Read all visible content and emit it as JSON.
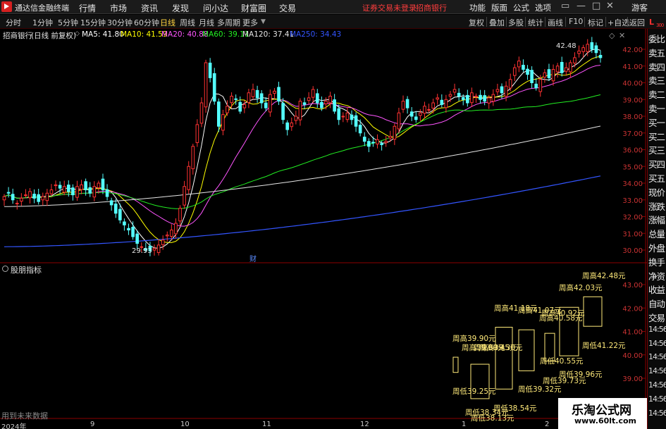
{
  "app": {
    "title": "通达信金融终端",
    "menu": [
      "行情",
      "市场",
      "资讯",
      "发现",
      "问小达",
      "财富圈",
      "交易"
    ],
    "warning": "证券交易未登录",
    "stock_short": "招商银行",
    "right_menu": [
      "功能",
      "版面",
      "公式",
      "选项"
    ],
    "guest": "游客",
    "window_buttons": [
      "▭",
      "—",
      "□",
      "✕"
    ]
  },
  "toolbar": {
    "periods": [
      "分时",
      "1分钟",
      "5分钟",
      "15分钟",
      "30分钟",
      "60分钟",
      "日线",
      "周线",
      "月线",
      "多周期",
      "更多"
    ],
    "active_period": "日线",
    "right_buttons": [
      "复权",
      "叠加",
      "多股",
      "统计",
      "画线",
      "F10",
      "标记",
      "+自选",
      "返回"
    ]
  },
  "ma_line": {
    "stock": "招商银行",
    "mode": "(日线 前复权)",
    "items": [
      {
        "text": "MA5: 41.80",
        "color": "#ffffff"
      },
      {
        "text": "MA10: 41.59",
        "color": "#ffff00"
      },
      {
        "text": "MA20: 40.88",
        "color": "#ff55ff"
      },
      {
        "text": "MA60: 39.11",
        "color": "#22ee22"
      },
      {
        "text": "MA120: 37.41",
        "color": "#e6e6e6"
      },
      {
        "text": "MA250: 34.43",
        "color": "#3355ff"
      }
    ]
  },
  "right_panel": {
    "top_label": "L",
    "top_sub": "300",
    "items": [
      "委比",
      "卖五",
      "卖四",
      "卖三",
      "卖二",
      "卖一",
      "买一",
      "买二",
      "买三",
      "买四",
      "买五",
      "现价",
      "涨跌",
      "涨幅",
      "总量",
      "外盘",
      "换手",
      "净资",
      "收益",
      "自动",
      "交易",
      "14:56",
      "14:56",
      "14:56",
      "14:56",
      "14:56",
      "14:56",
      "14:56"
    ]
  },
  "main_chart": {
    "y_ticks": [
      "42.00",
      "41.00",
      "40.00",
      "39.00",
      "38.00",
      "37.00",
      "36.00",
      "35.00",
      "34.00",
      "33.00",
      "32.00",
      "31.00",
      "30.00"
    ],
    "high_label": "42.48",
    "low_label": "29.93",
    "marker": "财"
  },
  "sub_chart": {
    "title": "股朋指标",
    "y_ticks": [
      "43.00",
      "42.00",
      "41.00",
      "40.00",
      "39.00"
    ],
    "labels": [
      "周高42.48元",
      "周高42.03元",
      "周高41.18元",
      "周高41.07元",
      "周高40.92元",
      "周高40.58元",
      "周高39.90元",
      "周高39.60元",
      "周高39.45元",
      "周高39.30元",
      "周低41.22元",
      "周低40.55元",
      "周低39.96元",
      "周低39.73元",
      "周低39.32元",
      "周低39.25元",
      "周低38.54元",
      "周低38.34元",
      "周低38.13元"
    ],
    "future_note": "用到未来数据"
  },
  "x_axis": {
    "labels": [
      "2024年",
      "9",
      "10",
      "11",
      "12",
      "1",
      "2"
    ]
  },
  "watermark": {
    "line1": "乐淘公式网",
    "line2": "www.60lt.com"
  },
  "chart_data": {
    "type": "candlestick",
    "title": "招商银行 (日线 前复权)",
    "x_labels": [
      "2024年",
      "9",
      "10",
      "11",
      "12",
      "1",
      "2"
    ],
    "ylim": [
      29.5,
      42.8
    ],
    "ma": {
      "MA5": 41.8,
      "MA10": 41.59,
      "MA20": 40.88,
      "MA60": 39.11,
      "MA120": 37.41,
      "MA250": 34.43
    },
    "close_series": [
      33.2,
      33.4,
      33.0,
      32.8,
      33.1,
      33.3,
      33.5,
      33.1,
      32.9,
      33.2,
      33.4,
      33.6,
      33.9,
      33.7,
      33.8,
      33.5,
      33.3,
      33.8,
      33.9,
      33.6,
      33.4,
      33.8,
      34.0,
      33.6,
      33.2,
      32.7,
      32.2,
      31.8,
      31.5,
      31.2,
      30.8,
      30.4,
      30.2,
      30.0,
      29.95,
      30.1,
      30.3,
      30.6,
      30.9,
      31.2,
      31.6,
      32.5,
      33.8,
      35.0,
      36.2,
      37.5,
      38.8,
      41.2,
      40.3,
      38.9,
      37.4,
      38.1,
      38.6,
      39.2,
      39.0,
      38.3,
      38.7,
      39.4,
      39.6,
      39.1,
      38.8,
      38.5,
      39.3,
      39.5,
      38.9,
      37.8,
      37.2,
      37.6,
      38.0,
      38.9,
      38.7,
      39.1,
      39.6,
      38.8,
      38.5,
      38.9,
      39.2,
      38.3,
      37.8,
      38.0,
      38.2,
      37.8,
      37.4,
      37.0,
      36.5,
      36.2,
      36.4,
      36.6,
      36.3,
      36.5,
      36.8,
      37.4,
      38.2,
      38.9,
      38.5,
      38.0,
      37.8,
      38.2,
      38.6,
      38.4,
      38.8,
      39.1,
      38.7,
      39.0,
      39.3,
      39.6,
      39.2,
      39.0,
      38.8,
      39.4,
      39.2,
      39.0,
      38.9,
      39.1,
      39.3,
      39.6,
      39.4,
      39.8,
      40.2,
      40.9,
      41.3,
      40.8,
      40.5,
      40.0,
      39.7,
      40.2,
      40.6,
      40.3,
      40.8,
      41.0,
      40.6,
      40.9,
      41.2,
      41.5,
      41.9,
      42.1,
      42.3,
      42.0,
      41.8,
      41.5
    ],
    "weekly_high_low": {
      "highs": [
        39.9,
        39.6,
        39.45,
        39.3,
        41.18,
        41.07,
        40.92,
        40.58,
        42.03,
        42.48
      ],
      "lows": [
        39.25,
        38.34,
        38.13,
        38.54,
        39.32,
        39.73,
        40.55,
        39.96,
        41.22
      ]
    }
  }
}
